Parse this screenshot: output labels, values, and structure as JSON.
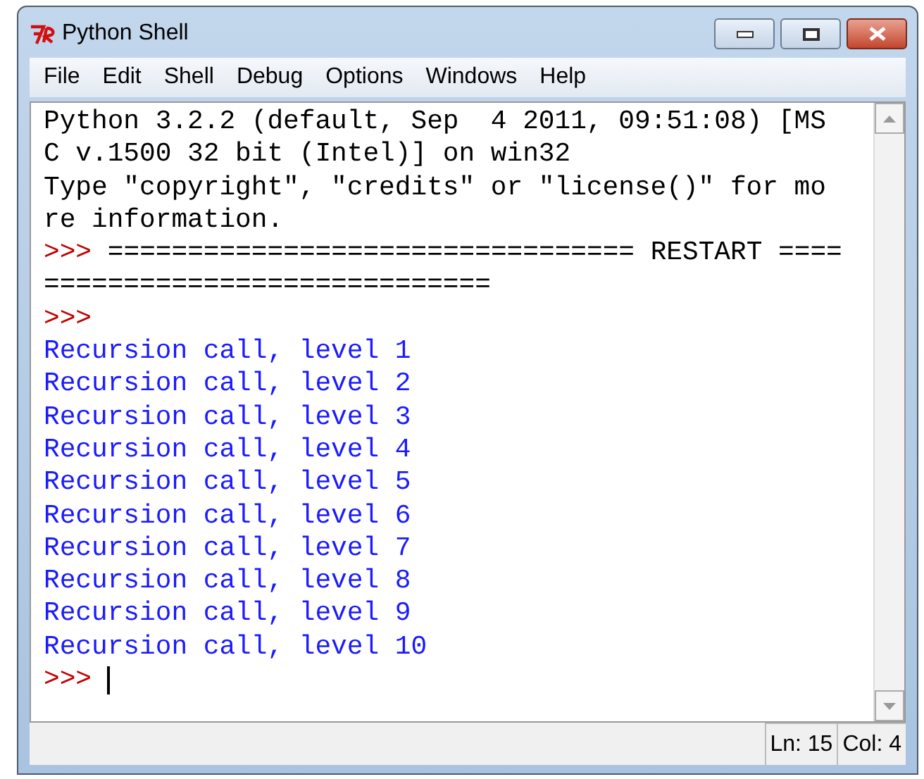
{
  "window": {
    "title": "Python Shell"
  },
  "menu": [
    "File",
    "Edit",
    "Shell",
    "Debug",
    "Options",
    "Windows",
    "Help"
  ],
  "lines": [
    {
      "kind": "output",
      "text": "Python 3.2.2 (default, Sep  4 2011, 09:51:08) [MS"
    },
    {
      "kind": "output",
      "text": "C v.1500 32 bit (Intel)] on win32"
    },
    {
      "kind": "output",
      "text": "Type \"copyright\", \"credits\" or \"license()\" for mo"
    },
    {
      "kind": "output",
      "text": "re information."
    },
    {
      "kind": "prompt",
      "prompt": ">>>",
      "text": "================================= RESTART ===="
    },
    {
      "kind": "output",
      "text": "============================"
    },
    {
      "kind": "prompt",
      "prompt": ">>>"
    },
    {
      "kind": "result",
      "text": "Recursion call, level 1"
    },
    {
      "kind": "result",
      "text": "Recursion call, level 2"
    },
    {
      "kind": "result",
      "text": "Recursion call, level 3"
    },
    {
      "kind": "result",
      "text": "Recursion call, level 4"
    },
    {
      "kind": "result",
      "text": "Recursion call, level 5"
    },
    {
      "kind": "result",
      "text": "Recursion call, level 6"
    },
    {
      "kind": "result",
      "text": "Recursion call, level 7"
    },
    {
      "kind": "result",
      "text": "Recursion call, level 8"
    },
    {
      "kind": "result",
      "text": "Recursion call, level 9"
    },
    {
      "kind": "result",
      "text": "Recursion call, level 10"
    },
    {
      "kind": "input",
      "prompt": ">>>"
    }
  ],
  "status_bar": {
    "line": "Ln: 15",
    "column": "Col: 4"
  }
}
